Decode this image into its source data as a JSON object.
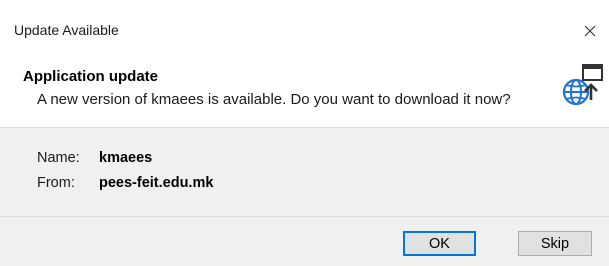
{
  "window": {
    "title": "Update Available",
    "close_icon": "close-icon"
  },
  "header": {
    "title": "Application update",
    "description": "A new version of kmaees is available. Do you want to download it now?",
    "icon": "globe-update-icon"
  },
  "details": {
    "name_label": "Name:",
    "name_value": "kmaees",
    "from_label": "From:",
    "from_value": "pees-feit.edu.mk"
  },
  "buttons": {
    "ok_label": "OK",
    "skip_label": "Skip"
  },
  "colors": {
    "accent": "#0078d7",
    "panel": "#f0f0f0",
    "button": "#e1e1e1"
  }
}
